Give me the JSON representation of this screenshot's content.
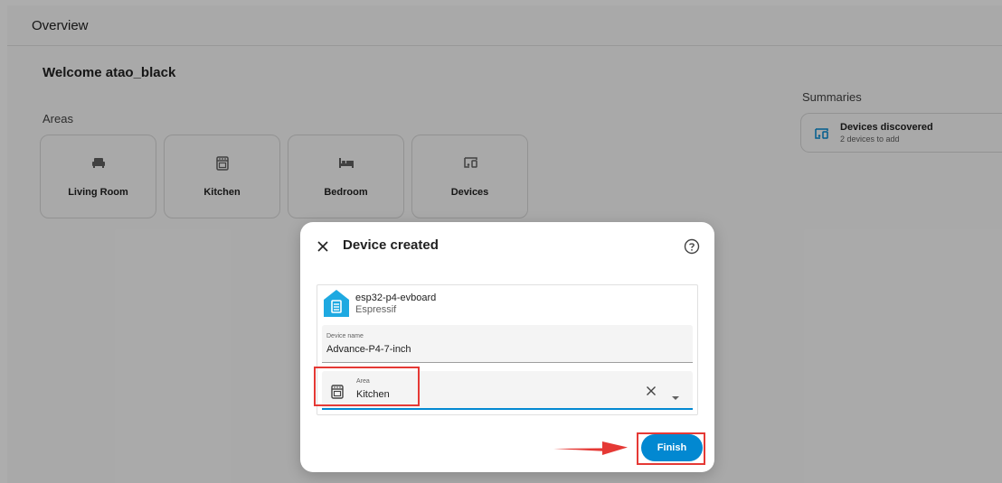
{
  "topbar": {
    "title": "Overview"
  },
  "welcome": "Welcome atao_black",
  "areas": {
    "label": "Areas",
    "items": [
      {
        "label": "Living Room",
        "icon": "sofa-icon"
      },
      {
        "label": "Kitchen",
        "icon": "stove-icon"
      },
      {
        "label": "Bedroom",
        "icon": "bed-icon"
      },
      {
        "label": "Devices",
        "icon": "devices-icon"
      }
    ]
  },
  "summaries": {
    "label": "Summaries",
    "card": {
      "title": "Devices discovered",
      "subtitle": "2 devices to add",
      "icon": "devices-icon"
    }
  },
  "dialog": {
    "title": "Device created",
    "device": {
      "name": "esp32-p4-evboard",
      "manufacturer": "Espressif"
    },
    "device_name_field": {
      "label": "Device name",
      "value": "Advance-P4-7-inch"
    },
    "area_field": {
      "label": "Area",
      "value": "Kitchen"
    },
    "finish_label": "Finish"
  },
  "colors": {
    "accent": "#0288d1",
    "annotation": "#e53935"
  }
}
